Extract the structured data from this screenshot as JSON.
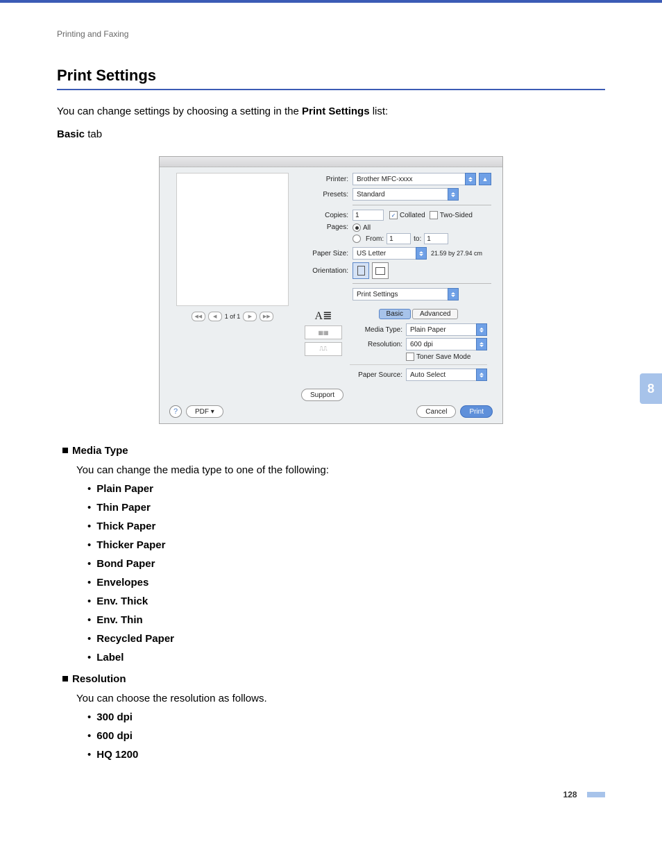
{
  "breadcrumb": "Printing and Faxing",
  "heading": "Print Settings",
  "intro_prefix": "You can change settings by choosing a setting in the ",
  "intro_bold": "Print Settings",
  "intro_suffix": " list:",
  "tab_name_bold": "Basic",
  "tab_name_suffix": " tab",
  "dialog": {
    "printer_label": "Printer:",
    "printer_value": "Brother MFC-xxxx",
    "presets_label": "Presets:",
    "presets_value": "Standard",
    "copies_label": "Copies:",
    "copies_value": "1",
    "collated_label": "Collated",
    "twosided_label": "Two-Sided",
    "pages_label": "Pages:",
    "pages_all": "All",
    "pages_from": "From:",
    "pages_from_value": "1",
    "pages_to": "to:",
    "pages_to_value": "1",
    "papersize_label": "Paper Size:",
    "papersize_value": "US Letter",
    "papersize_dim": "21.59 by 27.94 cm",
    "orientation_label": "Orientation:",
    "panel_select": "Print Settings",
    "tab_basic": "Basic",
    "tab_advanced": "Advanced",
    "mediatype_label": "Media Type:",
    "mediatype_value": "Plain Paper",
    "resolution_label": "Resolution:",
    "resolution_value": "600 dpi",
    "tonersave_label": "Toner Save Mode",
    "papersource_label": "Paper Source:",
    "papersource_value": "Auto Select",
    "support_btn": "Support",
    "pdf_btn": "PDF ▾",
    "cancel_btn": "Cancel",
    "print_btn": "Print",
    "preview_nav": "1 of 1"
  },
  "sections": [
    {
      "title": "Media Type",
      "desc": "You can change the media type to one of the following:",
      "options": [
        "Plain Paper",
        "Thin Paper",
        "Thick Paper",
        "Thicker Paper",
        "Bond Paper",
        "Envelopes",
        "Env. Thick",
        "Env. Thin",
        "Recycled Paper",
        "Label"
      ]
    },
    {
      "title": "Resolution",
      "desc": "You can choose the resolution as follows.",
      "options": [
        "300 dpi",
        "600 dpi",
        "HQ 1200"
      ]
    }
  ],
  "chapter_number": "8",
  "page_number": "128"
}
